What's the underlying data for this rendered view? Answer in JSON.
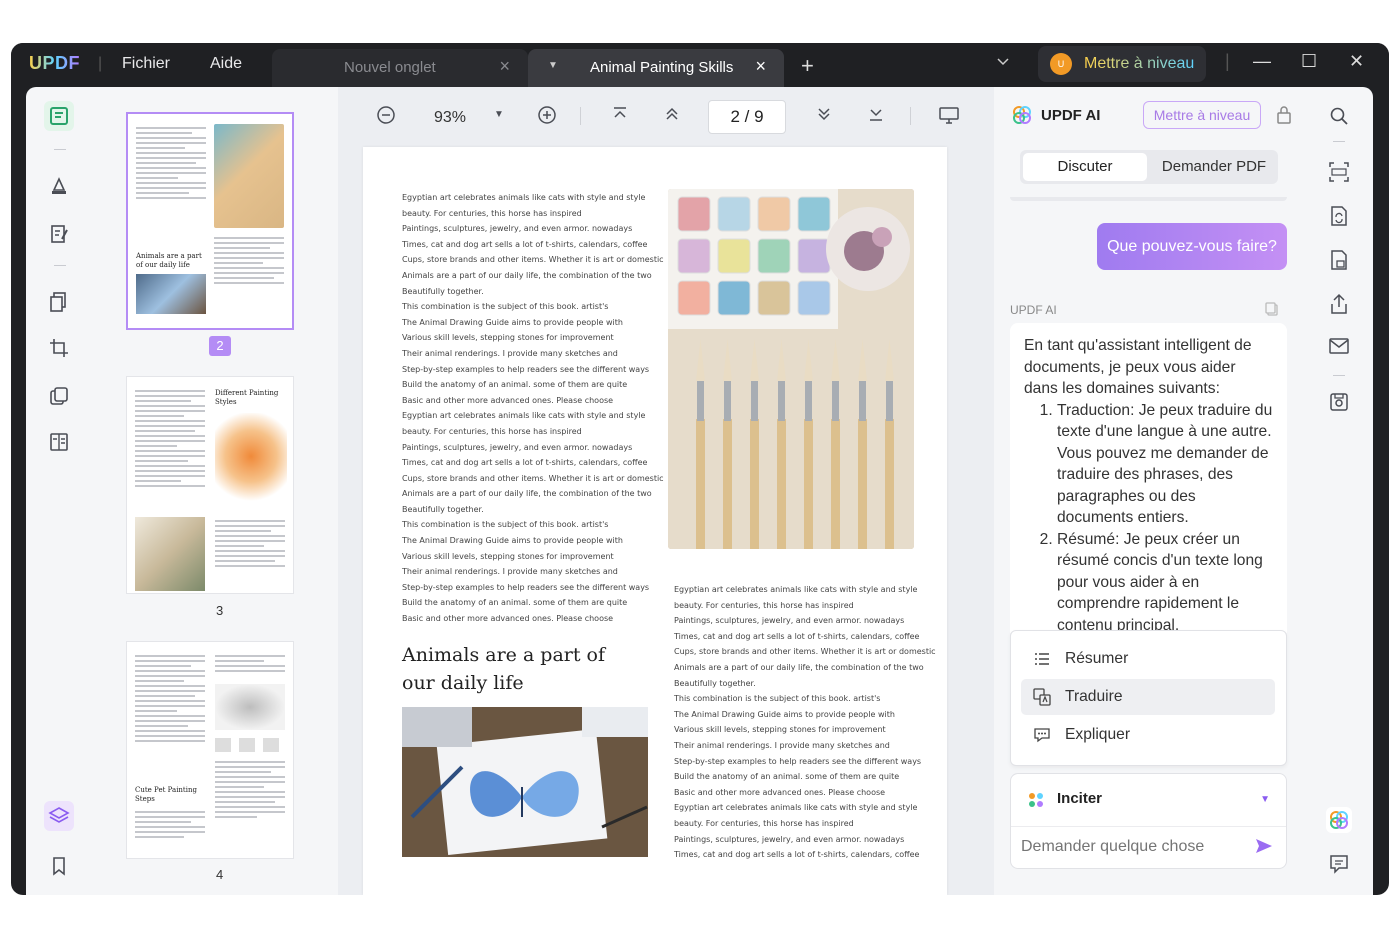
{
  "app": {
    "logo": "UPDF",
    "menu": [
      "Fichier",
      "Aide"
    ],
    "tabs": [
      {
        "label": "Nouvel onglet",
        "active": false
      },
      {
        "label": "Animal Painting Skills",
        "active": true
      }
    ],
    "upgrade_label": "Mettre à niveau",
    "avatar_initials": "U"
  },
  "toolbar": {
    "zoom": "93%",
    "page_indicator": "2 / 9"
  },
  "thumbnails": {
    "pages": [
      "2",
      "3",
      "4"
    ],
    "p2_heading": "Animals are a part of our daily life",
    "p3_heading": "Different Painting Styles",
    "p4_heading": "Cute Pet Painting Steps"
  },
  "document": {
    "col1_lines": [
      "Egyptian art celebrates animals like cats with style and style",
      "beauty. For centuries, this horse has inspired",
      "Paintings, sculptures, jewelry, and even armor. nowadays",
      "Times, cat and dog art sells a lot of t-shirts, calendars, coffee",
      "Cups, store brands and other items. Whether it is art or domestic",
      "Animals are a part of our daily life, the combination of the two",
      "Beautifully together.",
      "This combination is the subject of this book. artist's",
      "The Animal Drawing Guide aims to provide people with",
      "Various skill levels, stepping stones for improvement",
      "Their animal renderings. I provide many sketches and",
      "Step-by-step examples to help readers see the different ways",
      "Build the anatomy of an animal. some of them are quite",
      "Basic and other more advanced ones. Please choose",
      "Egyptian art celebrates animals like cats with style and style",
      "beauty. For centuries, this horse has inspired",
      "Paintings, sculptures, jewelry, and even armor. nowadays",
      "Times, cat and dog art sells a lot of t-shirts, calendars, coffee",
      "Cups, store brands and other items. Whether it is art or domestic",
      "Animals are a part of our daily life, the combination of the two",
      "Beautifully together.",
      "This combination is the subject of this book. artist's",
      "The Animal Drawing Guide aims to provide people with",
      "Various skill levels, stepping stones for improvement",
      "Their animal renderings. I provide many sketches and",
      "Step-by-step examples to help readers see the different ways",
      "Build the anatomy of an animal. some of them are quite",
      "Basic and other more advanced ones. Please choose"
    ],
    "heading": "Animals are a part of our daily life",
    "col2_lines": [
      "Egyptian art celebrates animals like cats with style and style",
      "beauty. For centuries, this horse has inspired",
      "Paintings, sculptures, jewelry, and even armor. nowadays",
      "Times, cat and dog art sells a lot of t-shirts, calendars, coffee",
      "Cups, store brands and other items. Whether it is art or domestic",
      "Animals are a part of our daily life, the combination of the two",
      "Beautifully together.",
      "This combination is the subject of this book. artist's",
      "The Animal Drawing Guide aims to provide people with",
      "Various skill levels, stepping stones for improvement",
      "Their animal renderings. I provide many sketches and",
      "Step-by-step examples to help readers see the different ways",
      "Build the anatomy of an animal. some of them are quite",
      "Basic and other more advanced ones. Please choose",
      "Egyptian art celebrates animals like cats with style and style",
      "beauty. For centuries, this horse has inspired",
      "Paintings, sculptures, jewelry, and even armor. nowadays",
      "Times, cat and dog art sells a lot of t-shirts, calendars, coffee"
    ]
  },
  "ai": {
    "title": "UPDF AI",
    "upgrade": "Mettre à niveau",
    "modes": [
      "Discuter",
      "Demander PDF"
    ],
    "user_message": "Que pouvez-vous faire?",
    "assistant_label": "UPDF AI",
    "reply_intro": "En tant qu'assistant intelligent de documents, je peux vous aider dans les domaines suivants:",
    "reply_items": [
      "Traduction: Je peux traduire du texte d'une langue à une autre. Vous pouvez me demander de traduire des phrases, des paragraphes ou des documents entiers.",
      "Résumé: Je peux créer un résumé concis d'un texte long pour vous aider à en comprendre rapidement le contenu principal."
    ],
    "quick_actions": [
      "Résumer",
      "Traduire",
      "Expliquer"
    ],
    "prompt_title": "Inciter",
    "input_placeholder": "Demander quelque chose"
  },
  "colors": {
    "accent": "#b48cf5",
    "titlebar": "#1f2023",
    "panel": "#f5f6f8"
  }
}
